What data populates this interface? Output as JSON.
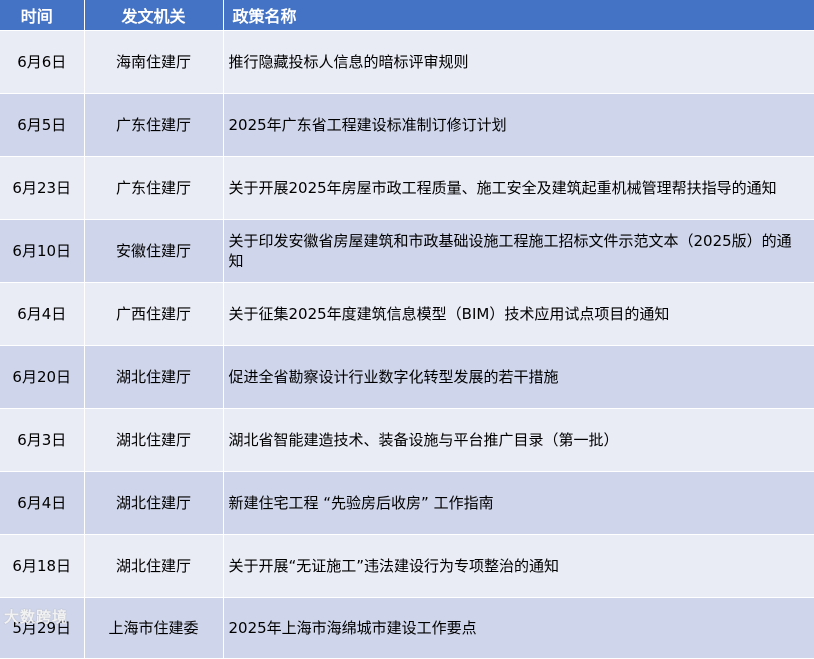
{
  "table": {
    "headers": {
      "date": "时间",
      "agency": "发文机关",
      "name": "政策名称"
    },
    "rows": [
      {
        "date": "6月6日",
        "agency": "海南住建厅",
        "name": "推行隐藏投标人信息的暗标评审规则"
      },
      {
        "date": "6月5日",
        "agency": "广东住建厅",
        "name": "2025年广东省工程建设标准制订修订计划"
      },
      {
        "date": "6月23日",
        "agency": "广东住建厅",
        "name": "关于开展2025年房屋市政工程质量、施工安全及建筑起重机械管理帮扶指导的通知"
      },
      {
        "date": "6月10日",
        "agency": "安徽住建厅",
        "name": "关于印发安徽省房屋建筑和市政基础设施工程施工招标文件示范文本（2025版）的通知"
      },
      {
        "date": "6月4日",
        "agency": "广西住建厅",
        "name": "关于征集2025年度建筑信息模型（BIM）技术应用试点项目的通知"
      },
      {
        "date": "6月20日",
        "agency": "湖北住建厅",
        "name": "促进全省勘察设计行业数字化转型发展的若干措施"
      },
      {
        "date": "6月3日",
        "agency": "湖北住建厅",
        "name": "湖北省智能建造技术、装备设施与平台推广目录（第一批）"
      },
      {
        "date": "6月4日",
        "agency": "湖北住建厅",
        "name": "新建住宅工程 “先验房后收房” 工作指南"
      },
      {
        "date": "6月18日",
        "agency": "湖北住建厅",
        "name": "关于开展“无证施工”违法建设行为专项整治的通知"
      },
      {
        "date": "5月29日",
        "agency": "上海市住建委",
        "name": "2025年上海市海绵城市建设工作要点"
      }
    ]
  },
  "watermark": "大数跨境",
  "colors": {
    "header_bg": "#4472c4",
    "row_light": "#e9ebf5",
    "row_dark": "#cfd5ea"
  }
}
